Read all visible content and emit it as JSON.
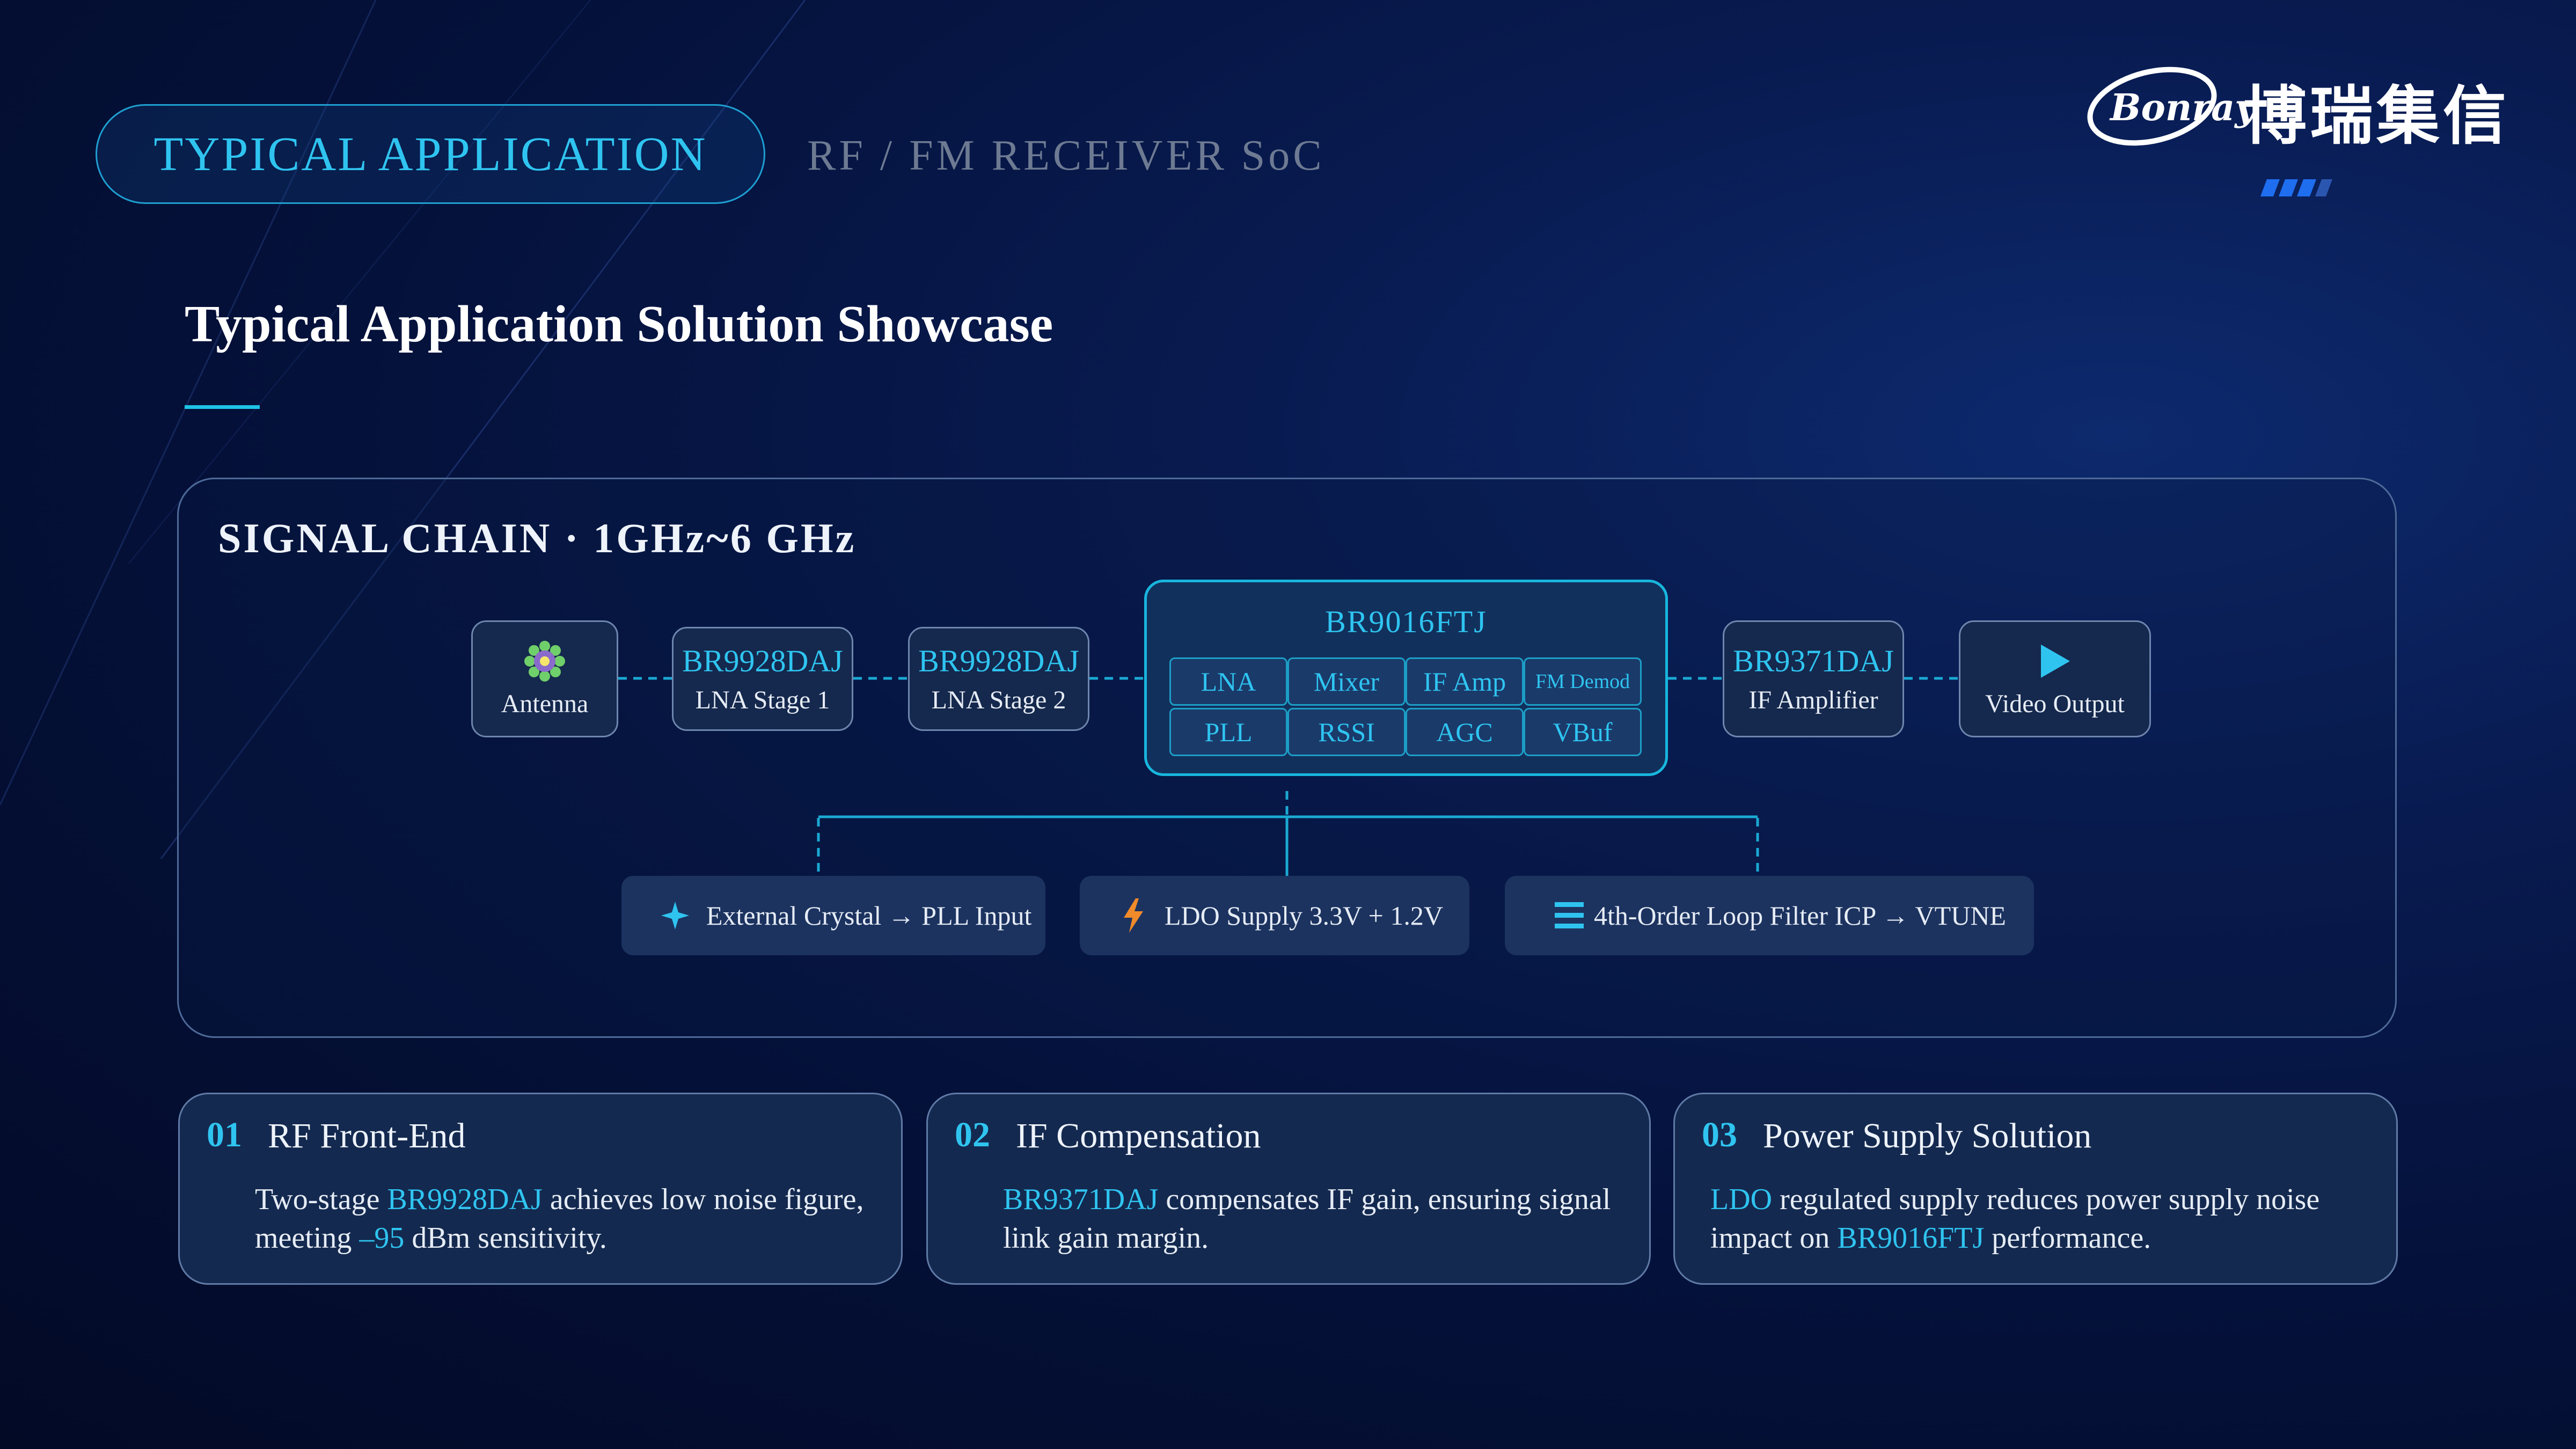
{
  "header": {
    "pill_label": "TYPICAL APPLICATION",
    "subtitle": "RF / FM RECEIVER SoC",
    "logo_text": "Bonray",
    "logo_cn": "博瑞集信"
  },
  "main_title": "Typical Application Solution Showcase",
  "signal_chain": {
    "title": "SIGNAL CHAIN · 1GHz~6 GHz",
    "blocks": [
      {
        "part": "",
        "role": "Antenna",
        "icon": "gear-icon"
      },
      {
        "part": "BR9928DAJ",
        "role": "LNA Stage 1"
      },
      {
        "part": "BR9928DAJ",
        "role": "LNA Stage 2"
      },
      {
        "part": "BR9371DAJ",
        "role": "IF Amplifier"
      },
      {
        "part": "",
        "role": "Video Output",
        "icon": "play-icon"
      }
    ],
    "soc": {
      "title": "BR9016FTJ",
      "cells": [
        "LNA",
        "Mixer",
        "IF Amp",
        "FM Demod",
        "PLL",
        "RSSI",
        "AGC",
        "VBuf"
      ]
    },
    "inputs": [
      {
        "label": "External Crystal → PLL Input",
        "icon": "sparkle-icon"
      },
      {
        "label": "LDO Supply 3.3V + 1.2V",
        "icon": "lightning-icon"
      },
      {
        "label": "4th-Order Loop Filter ICP → VTUNE",
        "icon": "menu-icon"
      }
    ]
  },
  "cards": [
    {
      "num": "01",
      "title": "RF Front-End",
      "body": [
        {
          "t": "Two-stage ",
          "hl": false
        },
        {
          "t": "BR9928DAJ",
          "hl": true
        },
        {
          "t": " achieves low noise figure, meeting ",
          "hl": false
        },
        {
          "t": "–95",
          "hl": true
        },
        {
          "t": " dBm sensitivity.",
          "hl": false
        }
      ]
    },
    {
      "num": "02",
      "title": "IF Compensation",
      "body": [
        {
          "t": "BR9371DAJ",
          "hl": true
        },
        {
          "t": " compensates IF gain, ensuring signal link gain margin.",
          "hl": false
        }
      ]
    },
    {
      "num": "03",
      "title": "Power Supply Solution",
      "body": [
        {
          "t": "LDO",
          "hl": true
        },
        {
          "t": " regulated supply reduces power supply noise impact on ",
          "hl": false
        },
        {
          "t": "BR9016FTJ",
          "hl": true
        },
        {
          "t": " performance.",
          "hl": false
        }
      ]
    }
  ],
  "colors": {
    "accent": "#2fc4f0",
    "connector": "#1aa9d3",
    "lightning": "#f08a2a",
    "background": "#04113a"
  }
}
